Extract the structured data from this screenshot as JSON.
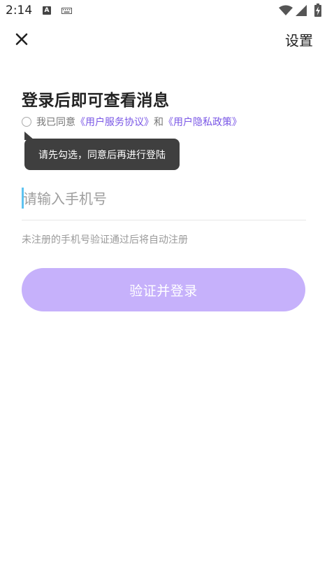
{
  "status_bar": {
    "time": "2:14",
    "a_indicator": "A",
    "icons": [
      "a-indicator-icon",
      "keyboard-icon",
      "wifi-icon",
      "signal-icon",
      "battery-icon"
    ]
  },
  "nav": {
    "close_icon": "close-icon",
    "settings_label": "设置"
  },
  "title": "登录后即可查看消息",
  "agreement": {
    "prefix": "我已同意",
    "user_agreement": "《用户服务协议》",
    "conjunction": "和",
    "privacy_policy": "《用户隐私政策》"
  },
  "tooltip": "请先勾选，同意后再进行登陆",
  "phone_input": {
    "placeholder": "请输入手机号",
    "value": ""
  },
  "hint": "未注册的手机号验证通过后将自动注册",
  "login_button": "验证并登录",
  "colors": {
    "accent": "#7a57e6",
    "button_bg": "#c6b1fb",
    "tooltip_bg": "#3f3f3f",
    "cursor": "#5ec3f0"
  }
}
